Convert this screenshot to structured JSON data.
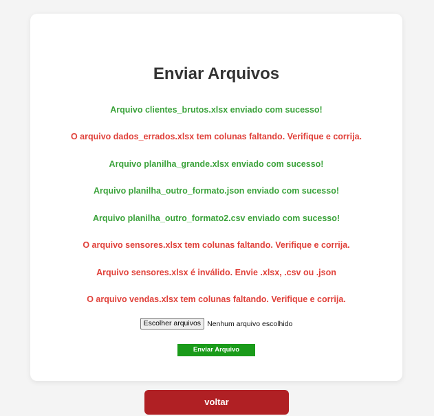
{
  "page": {
    "title": "Enviar Arquivos"
  },
  "colors": {
    "success": "#3ca33c",
    "error": "#e0413a",
    "submit_button": "#1a9b1a",
    "back_button": "#b02024"
  },
  "messages": [
    {
      "text": "Arquivo clientes_brutos.xlsx enviado com sucesso!",
      "status": "success"
    },
    {
      "text": "O arquivo dados_errados.xlsx tem colunas faltando. Verifique e corrija.",
      "status": "error"
    },
    {
      "text": "Arquivo planilha_grande.xlsx enviado com sucesso!",
      "status": "success"
    },
    {
      "text": "Arquivo planilha_outro_formato.json enviado com sucesso!",
      "status": "success"
    },
    {
      "text": "Arquivo planilha_outro_formato2.csv enviado com sucesso!",
      "status": "success"
    },
    {
      "text": "O arquivo sensores.xlsx tem colunas faltando. Verifique e corrija.",
      "status": "error"
    },
    {
      "text": "Arquivo sensores.xlsx é inválido. Envie .xlsx, .csv ou .json",
      "status": "error"
    },
    {
      "text": "O arquivo vendas.xlsx tem colunas faltando. Verifique e corrija.",
      "status": "error"
    }
  ],
  "file_input": {
    "button_label": "Escolher arquivos",
    "status_text": "Nenhum arquivo escolhido"
  },
  "submit": {
    "label": "Enviar Arquivo"
  },
  "back": {
    "label": "voltar"
  }
}
